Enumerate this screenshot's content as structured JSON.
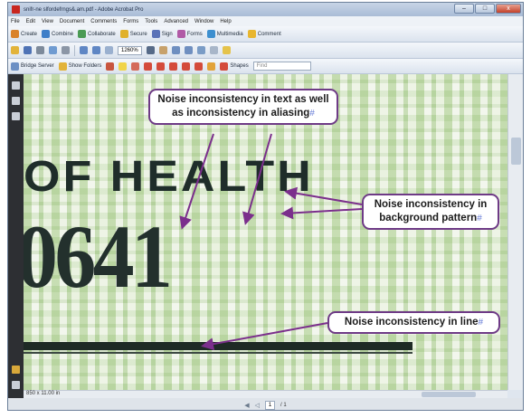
{
  "window": {
    "title": "snifr-ne slfordefrngs&.am.pdf - Adobe Acrobat Pro",
    "controls": [
      "–",
      "□",
      "x"
    ]
  },
  "menu": [
    "File",
    "Edit",
    "View",
    "Document",
    "Comments",
    "Forms",
    "Tools",
    "Advanced",
    "Window",
    "Help"
  ],
  "toolbar1": [
    {
      "label": "Create",
      "icon": "create-pdf-icon",
      "color": "#d9822b"
    },
    {
      "label": "Combine",
      "icon": "combine-icon",
      "color": "#3f7fc8"
    },
    {
      "label": "Collaborate",
      "icon": "collaborate-icon",
      "color": "#4a9a54"
    },
    {
      "label": "Secure",
      "icon": "lock-icon",
      "color": "#e0b12b"
    },
    {
      "label": "Sign",
      "icon": "pen-icon",
      "color": "#5a72b8"
    },
    {
      "label": "Forms",
      "icon": "forms-icon",
      "color": "#b15aa6"
    },
    {
      "label": "Multimedia",
      "icon": "film-icon",
      "color": "#3d8fcf"
    },
    {
      "label": "Comment",
      "icon": "comment-icon",
      "color": "#e8b62f"
    }
  ],
  "toolbar2": {
    "zoom": "1260%"
  },
  "toolbar3": [
    {
      "label": "Bridge Server",
      "icon": "server-icon",
      "color": "#6b8fc4"
    },
    {
      "label": "Show Folders",
      "icon": "folder-icon",
      "color": "#e2b33a"
    },
    {
      "label": "Stamp",
      "icon": "stamp-icon",
      "color": "#c8553f"
    },
    {
      "label": "Shapes",
      "icon": "shapes-icon",
      "color": "#d44b3b"
    }
  ],
  "find_placeholder": "Find",
  "document": {
    "heading_text": "OF HEALTH",
    "number_text": "0641",
    "page_size": "850 x 11.00 in"
  },
  "statusbar": {
    "current_page": "1",
    "page_of": "/ 1"
  },
  "annotations": {
    "text_noise": "Noise inconsistency in text as well as inconsistency in aliasing",
    "background_noise": "Noise inconsistency in background pattern",
    "line_noise": "Noise inconsistency in line",
    "marker": "#"
  },
  "colors": {
    "callout_border": "#6e3a86",
    "arrow": "#7b2f8c",
    "marker": "#6a7fd8",
    "background_pattern": "#dfe9d3",
    "print_ink": "#1f2d2a"
  }
}
